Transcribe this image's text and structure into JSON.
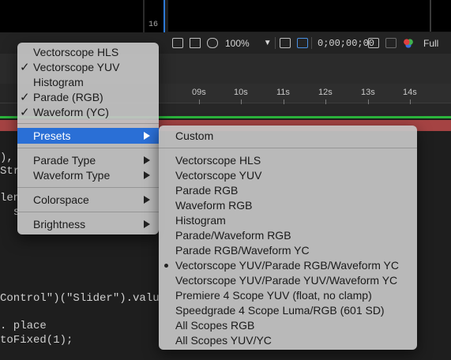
{
  "scope_panel": {
    "value": "16"
  },
  "toolbar": {
    "zoom": "100%",
    "timecode": "0;00;00;00",
    "resolution": "Full"
  },
  "ruler": {
    "ticks": [
      "09s",
      "10s",
      "11s",
      "12s",
      "13s",
      "14s"
    ]
  },
  "code": [
    "), ",
    "Str",
    "len",
    "  s",
    "Control\")(\"Slider\").valu",
    ". place",
    "toFixed(1);"
  ],
  "main_menu": {
    "items": [
      {
        "label": "Vectorscope HLS",
        "checked": false
      },
      {
        "label": "Vectorscope YUV",
        "checked": true
      },
      {
        "label": "Histogram",
        "checked": false
      },
      {
        "label": "Parade (RGB)",
        "checked": true
      },
      {
        "label": "Waveform (YC)",
        "checked": true
      },
      {
        "label": "Presets",
        "submenu": true,
        "highlighted": true
      },
      {
        "label": "Parade Type",
        "submenu": true
      },
      {
        "label": "Waveform Type",
        "submenu": true
      },
      {
        "label": "Colorspace",
        "submenu": true
      },
      {
        "label": "Brightness",
        "submenu": true
      }
    ],
    "check_glyph": "✓"
  },
  "presets_menu": {
    "items": [
      {
        "label": "Custom"
      },
      {
        "label": "Vectorscope HLS"
      },
      {
        "label": "Vectorscope YUV"
      },
      {
        "label": "Parade RGB"
      },
      {
        "label": "Waveform RGB"
      },
      {
        "label": "Histogram"
      },
      {
        "label": "Parade/Waveform RGB"
      },
      {
        "label": "Parade RGB/Waveform YC"
      },
      {
        "label": "Vectorscope YUV/Parade RGB/Waveform YC",
        "selected": true
      },
      {
        "label": "Vectorscope YUV/Parade YUV/Waveform YC"
      },
      {
        "label": "Premiere 4 Scope YUV (float, no clamp)"
      },
      {
        "label": "Speedgrade 4 Scope Luma/RGB (601 SD)"
      },
      {
        "label": "All Scopes RGB"
      },
      {
        "label": "All Scopes YUV/YC"
      }
    ]
  }
}
